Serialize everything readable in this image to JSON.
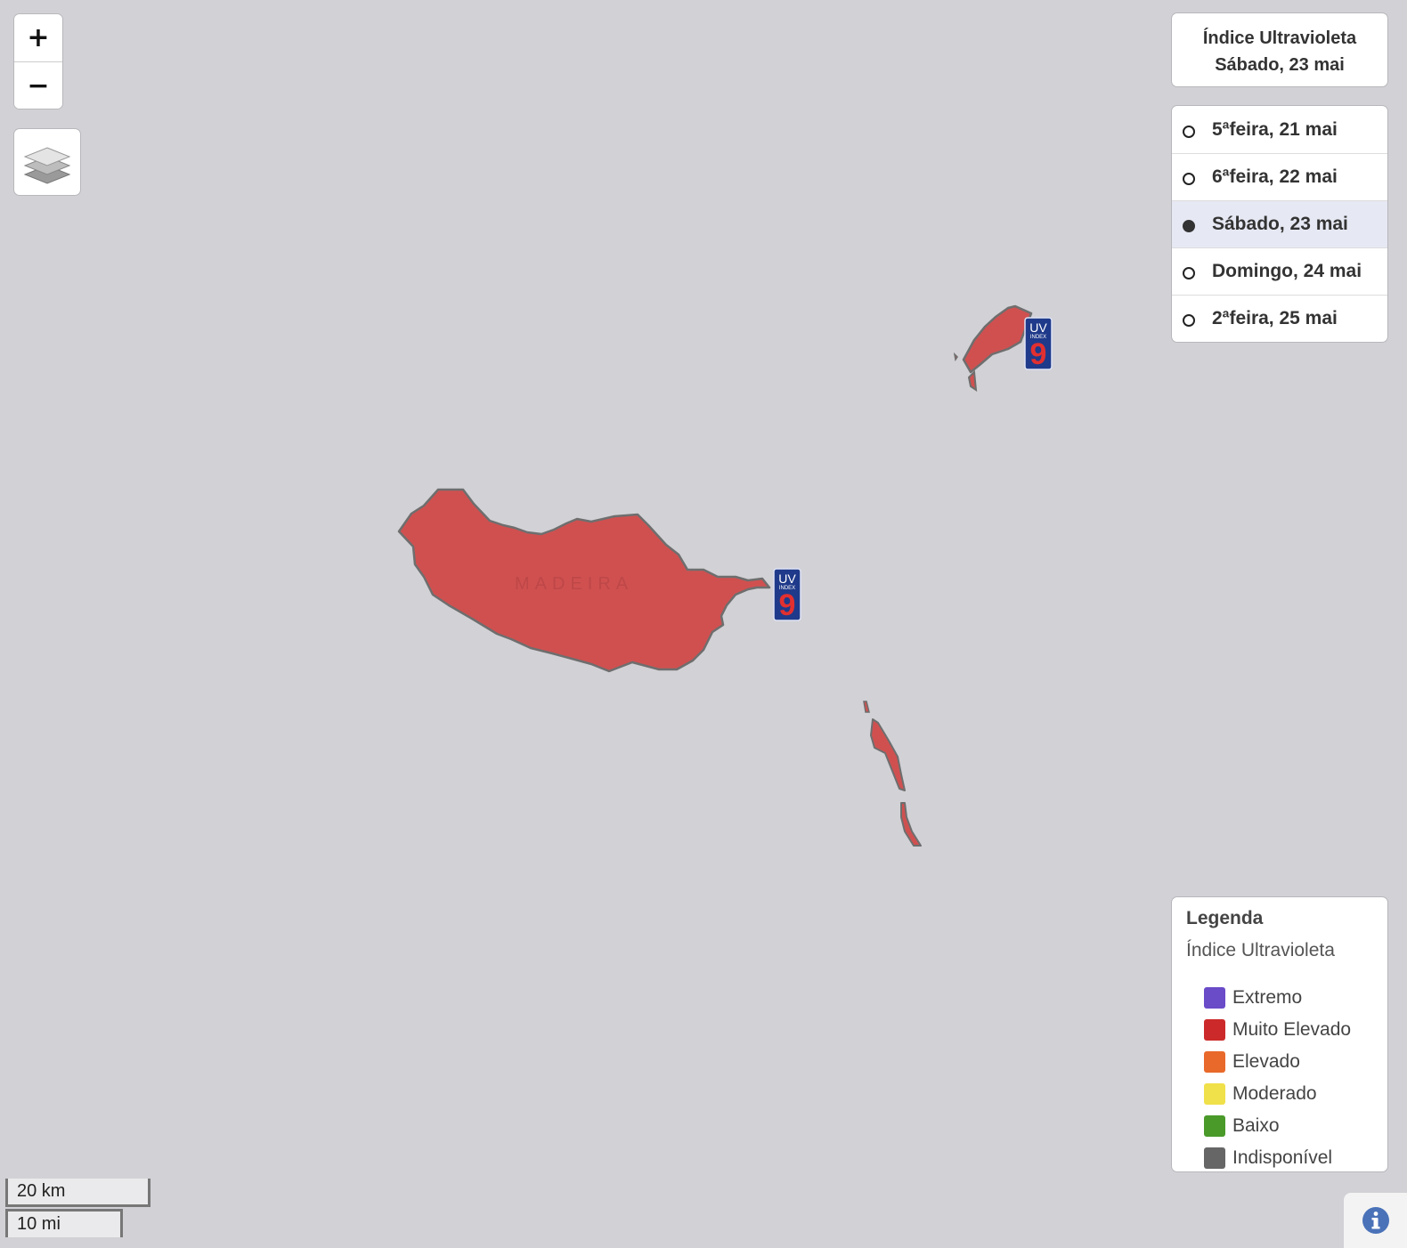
{
  "map": {
    "place_label": "MADEIRA",
    "land_color": "#d05050",
    "water_color": "#d1d1d6"
  },
  "controls": {
    "zoom_in_label": "+",
    "zoom_out_label": "−",
    "layers_icon": "layers-icon"
  },
  "title_panel": {
    "line1": "Índice Ultravioleta",
    "line2": "Sábado, 23 mai"
  },
  "dates": [
    {
      "label": "5ªfeira, 21 mai",
      "selected": false
    },
    {
      "label": "6ªfeira, 22 mai",
      "selected": false
    },
    {
      "label": "Sábado, 23 mai",
      "selected": true
    },
    {
      "label": "Domingo, 24 mai",
      "selected": false
    },
    {
      "label": "2ªfeira, 25 mai",
      "selected": false
    }
  ],
  "legend": {
    "title": "Legenda",
    "subtitle": "Índice Ultravioleta",
    "items": [
      {
        "label": "Extremo",
        "color": "#6a4bc8"
      },
      {
        "label": "Muito Elevado",
        "color": "#cc2a2a"
      },
      {
        "label": "Elevado",
        "color": "#e8692a"
      },
      {
        "label": "Moderado",
        "color": "#f0e04a"
      },
      {
        "label": "Baixo",
        "color": "#4a9a2a"
      },
      {
        "label": "Indisponível",
        "color": "#666666"
      }
    ]
  },
  "markers": [
    {
      "island": "Madeira",
      "top_text": "UV",
      "sub_text": "INDEX",
      "value": "9"
    },
    {
      "island": "Porto Santo",
      "top_text": "UV",
      "sub_text": "INDEX",
      "value": "9"
    }
  ],
  "scale": {
    "km_label": "20 km",
    "mi_label": "10 mi"
  },
  "info": {
    "icon": "info-icon"
  }
}
